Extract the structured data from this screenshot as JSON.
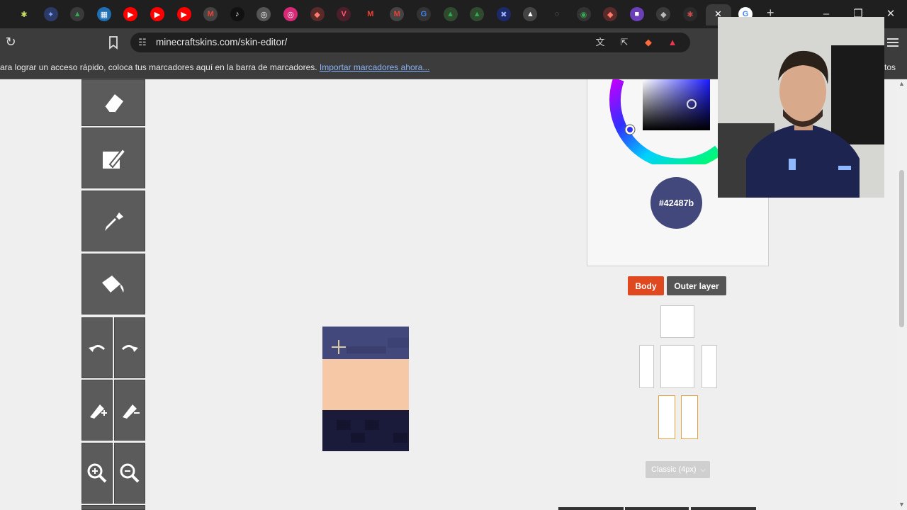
{
  "browser": {
    "tab_icons": [
      {
        "name": "puzzle-tab-icon",
        "color": "#1f1f1f",
        "glyph": "✱",
        "fg": "#c9e265"
      },
      {
        "name": "star-tab-icon",
        "color": "#2b3a66",
        "glyph": "✦",
        "fg": "#7aa7ff"
      },
      {
        "name": "drive-tab-icon",
        "color": "#3a3a3a",
        "glyph": "▲",
        "fg": "#34a853"
      },
      {
        "name": "grid-tab-icon",
        "color": "#1f6fb2",
        "glyph": "▦",
        "fg": "#ffffff"
      },
      {
        "name": "youtube-tab-icon",
        "color": "#ff0000",
        "glyph": "▶",
        "fg": "#ffffff"
      },
      {
        "name": "youtube-tab-icon",
        "color": "#ff0000",
        "glyph": "▶",
        "fg": "#ffffff"
      },
      {
        "name": "youtube-tab-icon",
        "color": "#ff0000",
        "glyph": "▶",
        "fg": "#ffffff"
      },
      {
        "name": "gmail-tab-icon",
        "color": "#444444",
        "glyph": "M",
        "fg": "#ea4335"
      },
      {
        "name": "tiktok-tab-icon",
        "color": "#111111",
        "glyph": "♪",
        "fg": "#ffffff"
      },
      {
        "name": "globe-tab-icon",
        "color": "#555555",
        "glyph": "◎",
        "fg": "#ffffff"
      },
      {
        "name": "instagram-tab-icon",
        "color": "#d62976",
        "glyph": "◎",
        "fg": "#ffffff"
      },
      {
        "name": "shield-tab-icon",
        "color": "#5a2a2a",
        "glyph": "◆",
        "fg": "#ff7b6b"
      },
      {
        "name": "vivaldi-tab-icon",
        "color": "#4a1f2a",
        "glyph": "V",
        "fg": "#ff5b6b"
      },
      {
        "name": "gmail-tab-icon",
        "color": "#1f1f1f",
        "glyph": "M",
        "fg": "#ea4335"
      },
      {
        "name": "gmail-tab-icon",
        "color": "#444444",
        "glyph": "M",
        "fg": "#ea4335"
      },
      {
        "name": "google-tab-icon",
        "color": "#333333",
        "glyph": "G",
        "fg": "#4285f4"
      },
      {
        "name": "drive-tab-icon",
        "color": "#2f4a2f",
        "glyph": "▲",
        "fg": "#34a853"
      },
      {
        "name": "drive-tab-icon",
        "color": "#2f4a2f",
        "glyph": "▲",
        "fg": "#34a853"
      },
      {
        "name": "x-tab-icon",
        "color": "#1d2a6a",
        "glyph": "✖",
        "fg": "#9fb3ff"
      },
      {
        "name": "triangle-tab-icon",
        "color": "#444444",
        "glyph": "▲",
        "fg": "#ffffff"
      },
      {
        "name": "loading-tab-icon",
        "color": "#1f1f1f",
        "glyph": "◌",
        "fg": "#888888"
      },
      {
        "name": "maps-tab-icon",
        "color": "#333333",
        "glyph": "◉",
        "fg": "#34a853"
      },
      {
        "name": "shield-tab-icon",
        "color": "#5a2a2a",
        "glyph": "◆",
        "fg": "#ff7b6b"
      },
      {
        "name": "twitch-tab-icon",
        "color": "#6b3fb8",
        "glyph": "■",
        "fg": "#ffffff"
      },
      {
        "name": "shield-tab-icon",
        "color": "#3a3a3a",
        "glyph": "◆",
        "fg": "#bbbbbb"
      },
      {
        "name": "puzzle-tab-icon",
        "color": "#2a2a2a",
        "glyph": "✱",
        "fg": "#c94b4b"
      }
    ],
    "active_tab_close": "✕",
    "new_tab": "+",
    "window": {
      "minimize": "–",
      "restore": "❐",
      "close": "✕"
    },
    "url": "minecraftskins.com/skin-editor/",
    "bookmarks_text": "ara lograr un acceso rápido, coloca tus marcadores aquí en la barra de marcadores.",
    "bookmarks_link": "Importar marcadores ahora...",
    "bookmarks_right": "tos"
  },
  "editor": {
    "color_hex": "#42487b",
    "layer_tabs": {
      "body": "Body",
      "outer": "Outer layer"
    },
    "model_select": "Classic (4px)",
    "colors": {
      "accent": "#e0481f",
      "tool_bg": "#5b5b5b",
      "leg_outline": "#e7a244"
    }
  }
}
